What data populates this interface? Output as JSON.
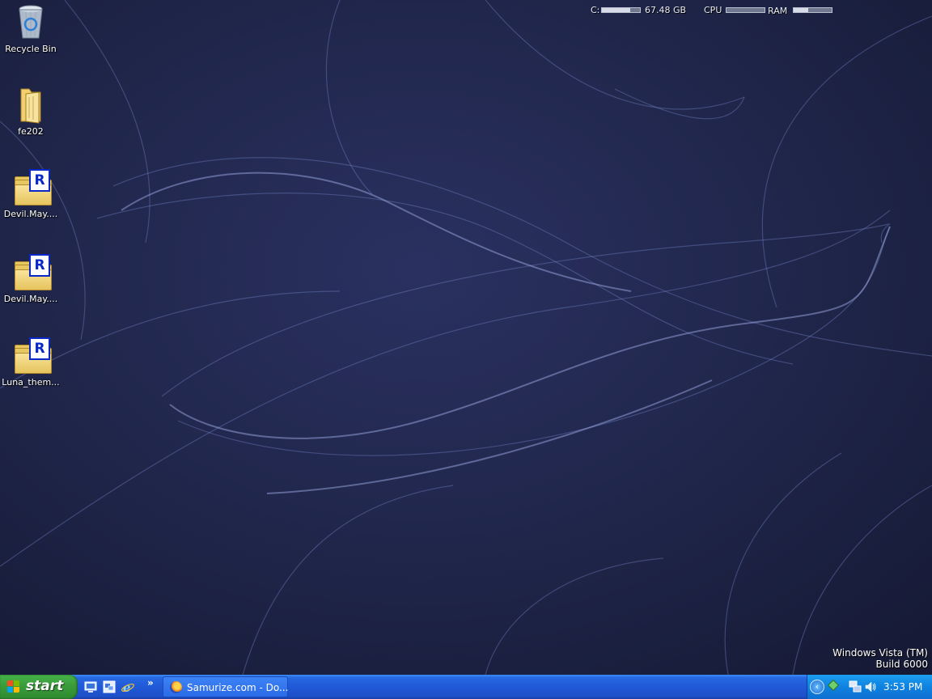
{
  "desktop": {
    "icons": [
      {
        "label": "Recycle Bin",
        "icon": "recycle-bin-icon"
      },
      {
        "label": "fe202",
        "icon": "folder-icon"
      },
      {
        "label": "Devil.May....",
        "icon": "winrar-archive-icon"
      },
      {
        "label": "Devil.May....",
        "icon": "winrar-archive-icon"
      },
      {
        "label": "Luna_them...",
        "icon": "winrar-archive-icon"
      }
    ],
    "watermark": {
      "line1": "Windows Vista (TM)",
      "line2": "Build 6000"
    }
  },
  "samurize": {
    "drive_label": "C:",
    "drive_free": "67.48 GB",
    "drive_used_fraction": 0.75,
    "cpu_label": "CPU",
    "cpu_fraction": 0.0,
    "ram_label": "RAM",
    "ram_fraction": 0.38
  },
  "taskbar": {
    "start_label": "start",
    "quick_launch": [
      "show-desktop-icon",
      "window-switcher-icon",
      "internet-explorer-icon"
    ],
    "chevron": "»",
    "tasks": [
      {
        "label": "Samurize.com - Do...",
        "icon": "firefox-icon"
      }
    ],
    "tray_icons": [
      "tray-expand-icon",
      "tray-app-icon",
      "network-icon",
      "volume-icon"
    ],
    "clock": "3:53 PM"
  },
  "colors": {
    "taskbar": "#2159d8",
    "start_button": "#3c9d3c",
    "tray": "#0f82e0",
    "wallpaper": "#1c2040"
  }
}
